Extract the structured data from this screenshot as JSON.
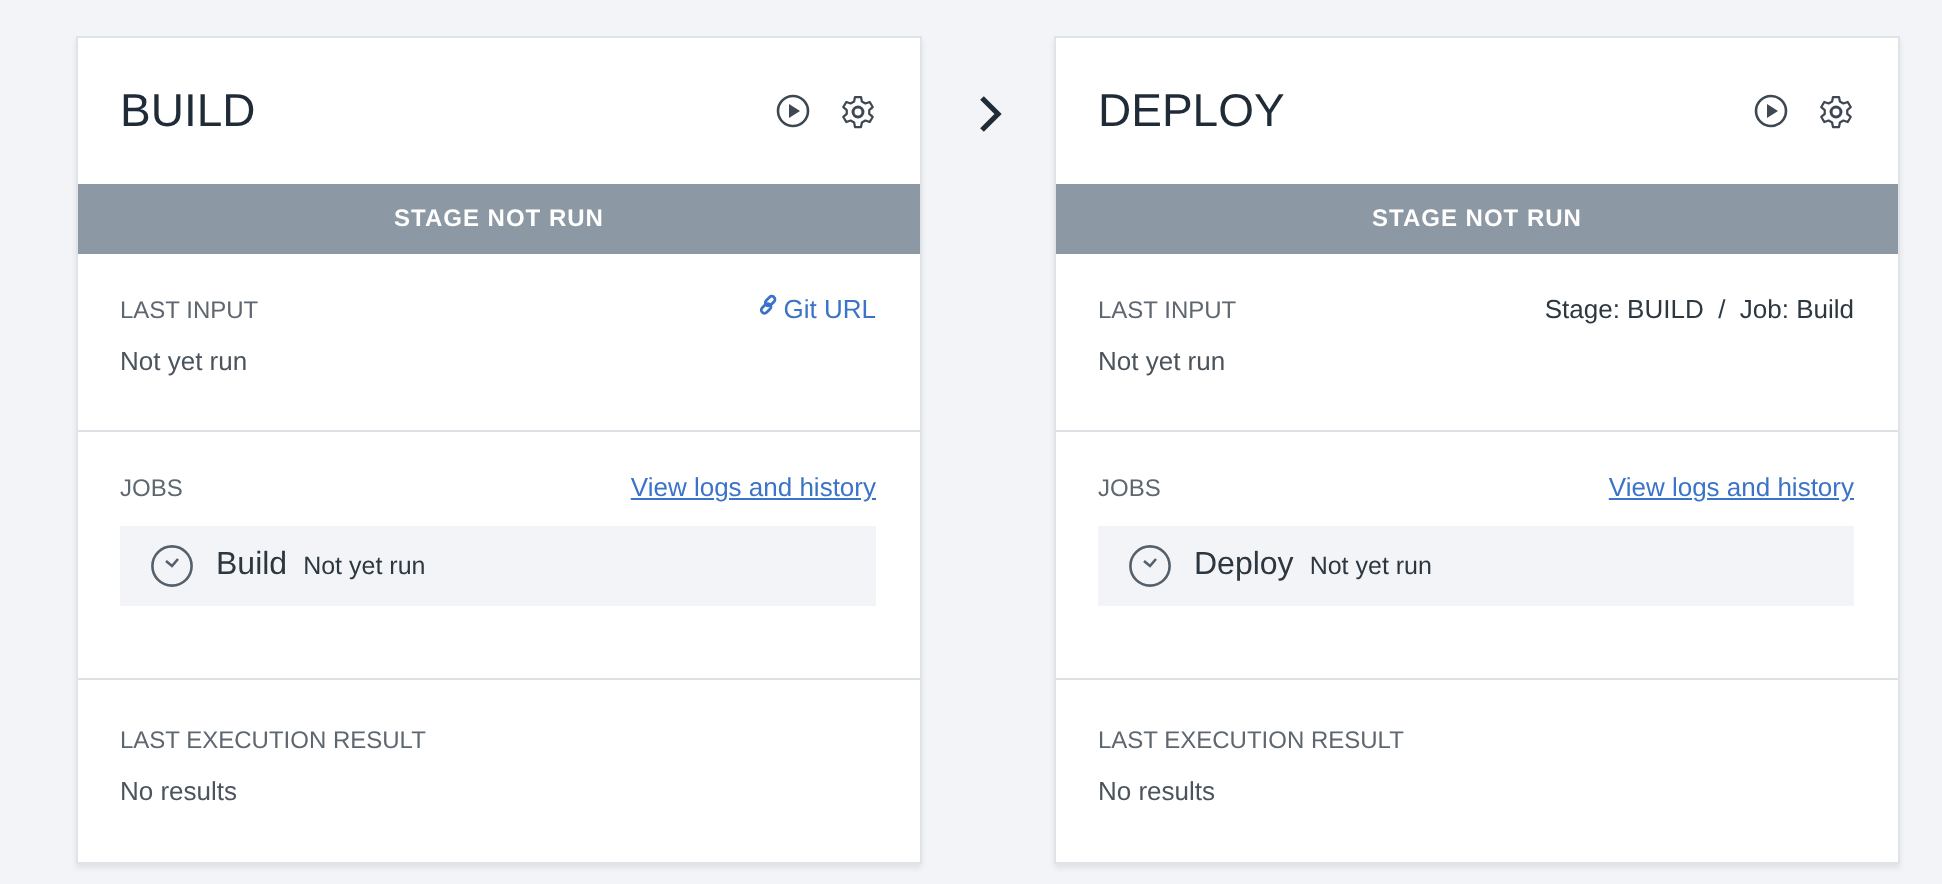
{
  "stages": [
    {
      "title": "BUILD",
      "status": "STAGE NOT RUN",
      "last_input": {
        "label": "LAST INPUT",
        "source": {
          "kind": "link",
          "text": "Git URL"
        },
        "value": "Not yet run"
      },
      "jobs": {
        "label": "JOBS",
        "link": "View logs and history",
        "items": [
          {
            "name": "Build",
            "status": "Not yet run"
          }
        ]
      },
      "result": {
        "label": "LAST EXECUTION RESULT",
        "value": "No results"
      }
    },
    {
      "title": "DEPLOY",
      "status": "STAGE NOT RUN",
      "last_input": {
        "label": "LAST INPUT",
        "source": {
          "kind": "text",
          "text": "Stage: BUILD  /  Job: Build"
        },
        "value": "Not yet run"
      },
      "jobs": {
        "label": "JOBS",
        "link": "View logs and history",
        "items": [
          {
            "name": "Deploy",
            "status": "Not yet run"
          }
        ]
      },
      "result": {
        "label": "LAST EXECUTION RESULT",
        "value": "No results"
      }
    }
  ]
}
